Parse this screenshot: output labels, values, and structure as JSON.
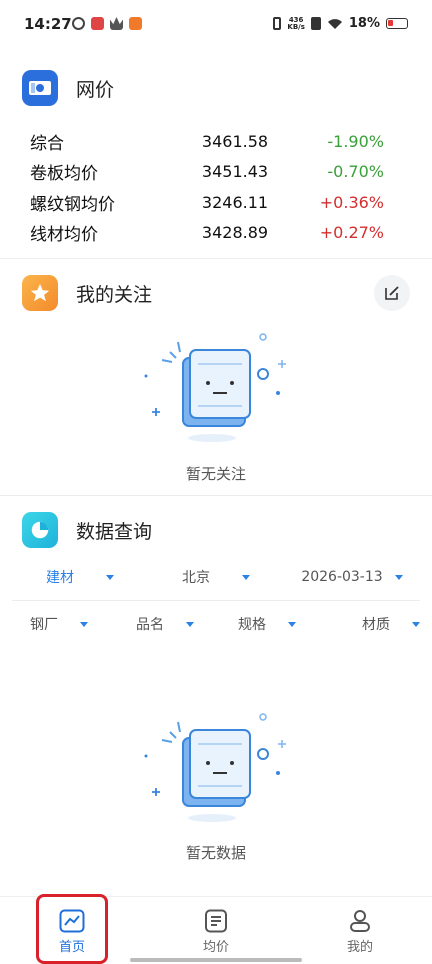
{
  "status_bar": {
    "time": "14:27",
    "net_speed_value": "436",
    "net_speed_unit": "KB/s",
    "battery": "18%",
    "icons": [
      "vibrate-icon",
      "sim-icon",
      "wifi-icon",
      "battery-icon"
    ]
  },
  "price_section": {
    "title": "网价",
    "icon": "money-icon",
    "rows": [
      {
        "name": "综合",
        "value": "3461.58",
        "change": "-1.90%",
        "trend": "down"
      },
      {
        "name": "卷板均价",
        "value": "3451.43",
        "change": "-0.70%",
        "trend": "down"
      },
      {
        "name": "螺纹钢均价",
        "value": "3246.11",
        "change": "+0.36%",
        "trend": "up"
      },
      {
        "name": "线材均价",
        "value": "3428.89",
        "change": "+0.27%",
        "trend": "up"
      }
    ]
  },
  "watch_section": {
    "title": "我的关注",
    "icon": "star-icon",
    "edit_icon": "edit-icon",
    "empty_text": "暂无关注"
  },
  "query_section": {
    "title": "数据查询",
    "icon": "pie-chart-icon",
    "filters_top": [
      "建材",
      "北京",
      "2026-03-13"
    ],
    "filters_bottom": [
      "钢厂",
      "品名",
      "规格",
      "材质"
    ],
    "empty_text": "暂无数据"
  },
  "bottom_nav": {
    "items": [
      {
        "label": "首页",
        "icon": "chart-line-icon"
      },
      {
        "label": "均价",
        "icon": "document-icon"
      },
      {
        "label": "我的",
        "icon": "user-icon"
      }
    ]
  },
  "colors": {
    "accent": "#1e6fd9",
    "down": "#3aa03a",
    "up": "#d32f2f",
    "watch_icon_bg": "#f7a23a",
    "price_icon_bg": "#2a6fdb",
    "query_icon_bg": "#2cc4e0"
  }
}
